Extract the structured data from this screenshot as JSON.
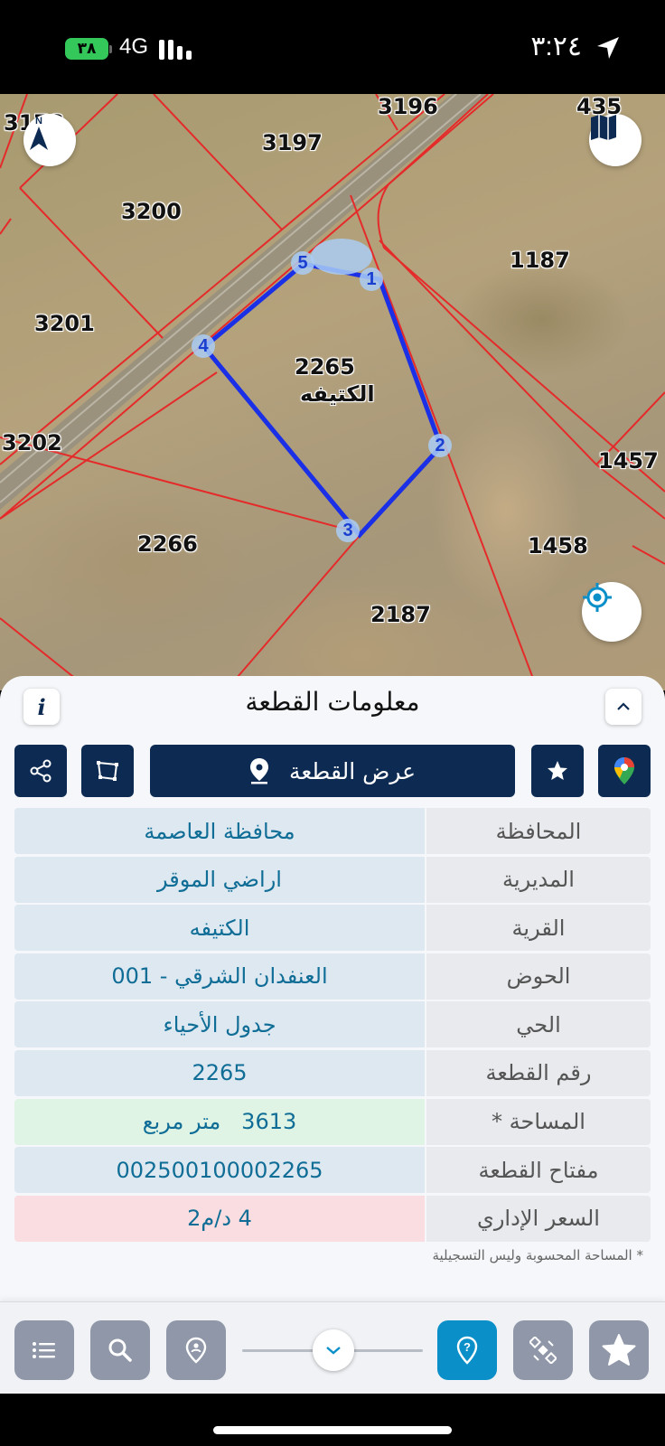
{
  "status_bar": {
    "battery": "٣٨",
    "network": "4G",
    "time": "٣:٢٤"
  },
  "map": {
    "parcel_numbers": [
      "3196",
      "435",
      "3197",
      "3200",
      "1187",
      "3201",
      "2265",
      "3202",
      "1457",
      "2266",
      "1458",
      "2187",
      "3178"
    ],
    "selected_parcel_number": "2265",
    "selected_parcel_name": "الكتيفه",
    "vertices": [
      "1",
      "2",
      "3",
      "4",
      "5"
    ],
    "boundary_color": "#1a2fe6",
    "parcel_line_color": "#e52a2a",
    "icons": [
      "north-compass-icon",
      "map-layers-icon",
      "locate-me-icon"
    ]
  },
  "panel": {
    "title": "معلومات القطعة",
    "show_parcel_label": "عرض القطعة",
    "action_icons": [
      "share-icon",
      "polygon-icon",
      "star-icon",
      "google-maps-icon"
    ],
    "rows": [
      {
        "label": "المحافظة",
        "value": "محافظة العاصمة",
        "tone": "blue"
      },
      {
        "label": "المديرية",
        "value": "اراضي الموقر",
        "tone": "blue"
      },
      {
        "label": "القرية",
        "value": "الكتيفه",
        "tone": "blue"
      },
      {
        "label": "الحوض",
        "value": "العنفدان الشرقي - 001",
        "tone": "blue"
      },
      {
        "label": "الحي",
        "value": "جدول الأحياء",
        "tone": "blue"
      },
      {
        "label": "رقم القطعة",
        "value": "2265",
        "tone": "blue"
      },
      {
        "label": "المساحة *",
        "value": "3613   متر مربع",
        "tone": "green"
      },
      {
        "label": "مفتاح القطعة",
        "value": "002500100002265",
        "tone": "blue"
      },
      {
        "label": "السعر الإداري",
        "value": "4 د/م2",
        "tone": "red"
      }
    ],
    "footnote": "* المساحة المحسوبة وليس التسجيلية"
  },
  "toolbar": {
    "buttons": [
      "list-icon",
      "search-icon",
      "pin-person-icon",
      "location-question-icon",
      "satellite-icon",
      "favorites-star-icon"
    ],
    "active_button": "location-question-icon",
    "accent_color": "#0a8fc8"
  }
}
